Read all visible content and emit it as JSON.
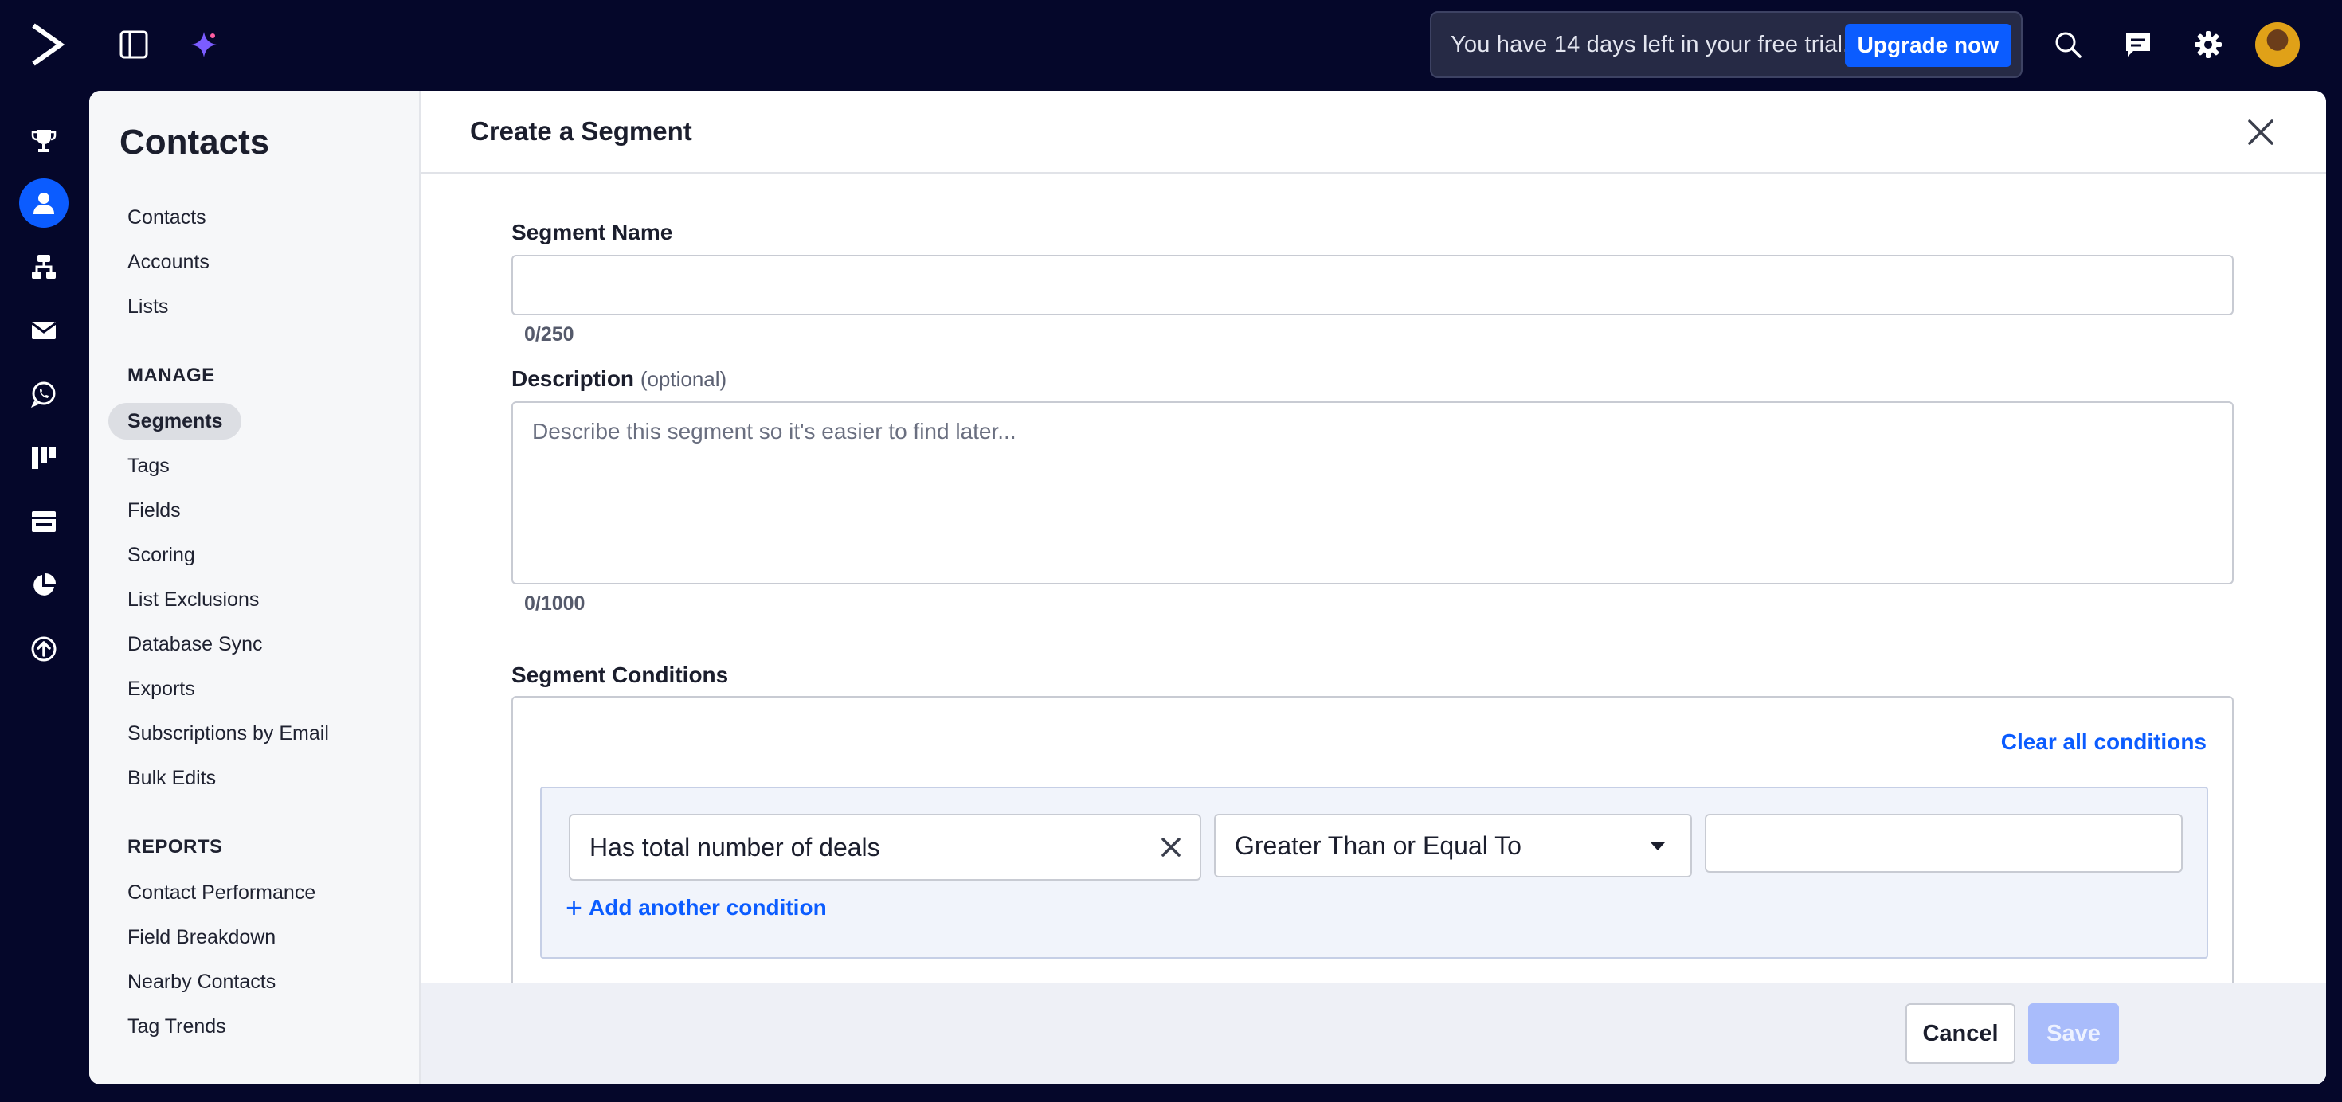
{
  "topbar": {
    "trial_text": "You have 14 days left in your free trial.",
    "upgrade_label": "Upgrade now"
  },
  "subnav": {
    "title": "Contacts",
    "items": [
      "Contacts",
      "Accounts",
      "Lists"
    ],
    "manage_heading": "MANAGE",
    "manage_items": [
      "Segments",
      "Tags",
      "Fields",
      "Scoring",
      "List Exclusions",
      "Database Sync",
      "Exports",
      "Subscriptions by Email",
      "Bulk Edits"
    ],
    "selected": "Segments",
    "reports_heading": "REPORTS",
    "report_items": [
      "Contact Performance",
      "Field Breakdown",
      "Nearby Contacts",
      "Tag Trends"
    ]
  },
  "modal": {
    "title": "Create a Segment",
    "segment_name": {
      "label": "Segment Name",
      "value": "",
      "counter": "0/250"
    },
    "description": {
      "label": "Description",
      "optional": "(optional)",
      "placeholder": "Describe this segment so it's easier to find later...",
      "counter": "0/1000"
    },
    "conditions": {
      "label": "Segment Conditions",
      "clear_all": "Clear all conditions",
      "field": "Has total number of deals",
      "operator": "Greater Than or Equal To",
      "value": "",
      "add_another": "Add another condition"
    },
    "footer": {
      "cancel": "Cancel",
      "save": "Save"
    }
  },
  "colors": {
    "background": "#05072a",
    "accent": "#0b5cff",
    "save_disabled": "#a9bcfb"
  }
}
